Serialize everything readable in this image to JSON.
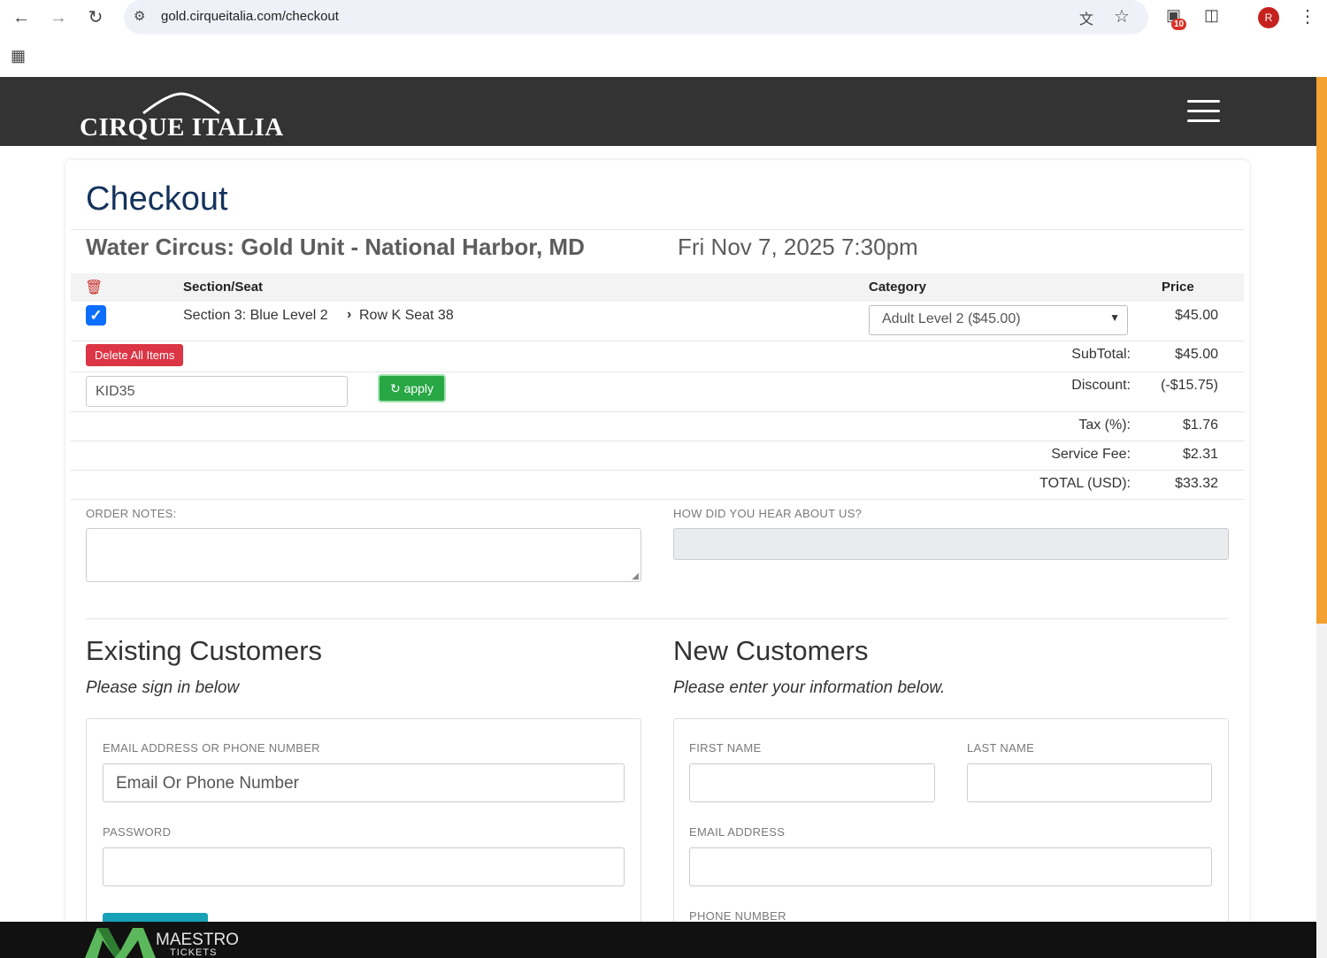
{
  "browser": {
    "url": "gold.cirqueitalia.com/checkout",
    "extension_badge": "10",
    "profile_initial": "R",
    "icons": [
      "back-icon",
      "forward-icon",
      "reload-icon",
      "tune-icon",
      "translate-icon",
      "star-icon",
      "extension-icon",
      "puzzle-icon",
      "more-icon",
      "apps-icon"
    ]
  },
  "site": {
    "logo_text": "CIRQUE ITALIA"
  },
  "checkout": {
    "title": "Checkout",
    "event_name": "Water Circus: Gold Unit - National Harbor, MD",
    "event_date": "Fri Nov 7, 2025 7:30pm",
    "table": {
      "headers": {
        "section_seat": "Section/Seat",
        "category": "Category",
        "price": "Price"
      },
      "rows": [
        {
          "section": "Section 3: Blue Level 2",
          "row_seat": "Row K Seat 38",
          "category": "Adult Level 2 ($45.00)",
          "price": "$45.00",
          "checked": true
        }
      ]
    },
    "delete_all_label": "Delete All Items",
    "coupon_value": "KID35",
    "apply_label": "apply",
    "totals": {
      "subtotal_label": "SubTotal:",
      "subtotal": "$45.00",
      "discount_label": "Discount:",
      "discount": "(-$15.75)",
      "tax_label": "Tax (%):",
      "tax": "$1.76",
      "fee_label": "Service Fee:",
      "fee": "$2.31",
      "total_label": "TOTAL (USD):",
      "total": "$33.32"
    },
    "order_notes_label": "ORDER NOTES:",
    "hear_label": "HOW DID YOU HEAR ABOUT US?"
  },
  "existing": {
    "title": "Existing Customers",
    "subtitle": "Please sign in below",
    "email_label": "EMAIL ADDRESS OR PHONE NUMBER",
    "email_placeholder": "Email Or Phone Number",
    "password_label": "PASSWORD"
  },
  "new_customers": {
    "title": "New Customers",
    "subtitle": "Please enter your information below.",
    "first_name_label": "FIRST NAME",
    "last_name_label": "LAST NAME",
    "email_label": "EMAIL ADDRESS",
    "phone_label": "PHONE NUMBER"
  },
  "footer": {
    "brand": "MAESTRO",
    "brand_sub": "TICKETS"
  },
  "colors": {
    "header_bg": "#333333",
    "title_blue": "#14325c",
    "danger": "#dc3545",
    "success": "#28a745",
    "scroll_accent": "#f4a131"
  }
}
